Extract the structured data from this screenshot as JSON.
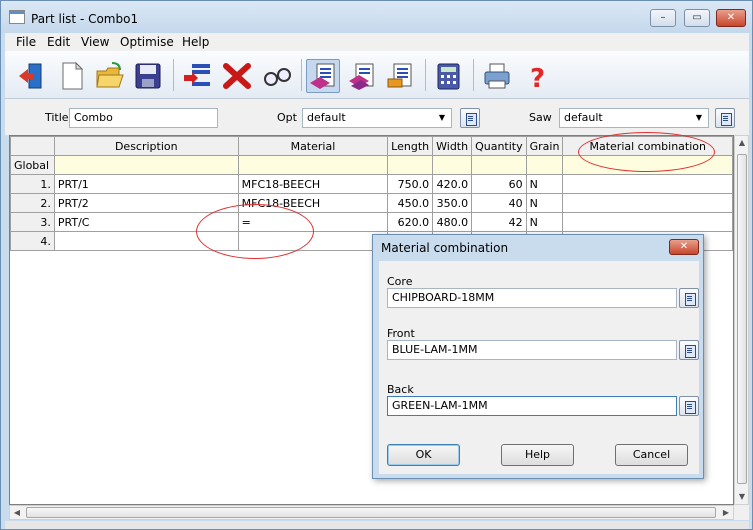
{
  "window": {
    "title": "Part list - Combo1",
    "controls": {
      "minimize": "–",
      "maximize": "▭",
      "close": "✕"
    }
  },
  "menu": [
    "File",
    "Edit",
    "View",
    "Optimise",
    "Help"
  ],
  "toolbar": {
    "icons": [
      "exit-door-icon",
      "new-document-icon",
      "open-folder-icon",
      "save-disk-icon",
      "insert-row-icon",
      "delete-x-icon",
      "find-glasses-icon",
      "part-list-icon",
      "board-list-icon",
      "edging-list-icon",
      "calculator-icon",
      "print-icon",
      "help-question-icon"
    ]
  },
  "form": {
    "title_label": "Title",
    "title_value": "Combo",
    "opt_label": "Opt",
    "opt_value": "default",
    "saw_label": "Saw",
    "saw_value": "default"
  },
  "grid": {
    "columns": [
      "Description",
      "Material",
      "Length",
      "Width",
      "Quantity",
      "Grain",
      "Material combination"
    ],
    "global_label": "Global",
    "rows": [
      {
        "n": "1.",
        "description": "PRT/1",
        "material": "MFC18-BEECH",
        "length": "750.0",
        "width": "420.0",
        "quantity": "60",
        "grain": "N"
      },
      {
        "n": "2.",
        "description": "PRT/2",
        "material": "MFC18-BEECH",
        "length": "450.0",
        "width": "350.0",
        "quantity": "40",
        "grain": "N"
      },
      {
        "n": "3.",
        "description": "PRT/C",
        "material": "=",
        "length": "620.0",
        "width": "480.0",
        "quantity": "42",
        "grain": "N"
      },
      {
        "n": "4.",
        "description": "",
        "material": "",
        "length": "",
        "width": "",
        "quantity": "",
        "grain": ""
      }
    ]
  },
  "dialog": {
    "title": "Material combination",
    "close": "✕",
    "core_label": "Core",
    "core_value": "CHIPBOARD-18MM",
    "front_label": "Front",
    "front_value": "BLUE-LAM-1MM",
    "back_label": "Back",
    "back_value": "GREEN-LAM-1MM",
    "ok": "OK",
    "help": "Help",
    "cancel": "Cancel"
  },
  "colors": {
    "annotation": "#e03030",
    "global_row": "#fffde0",
    "chrome": "#c9dcee"
  }
}
